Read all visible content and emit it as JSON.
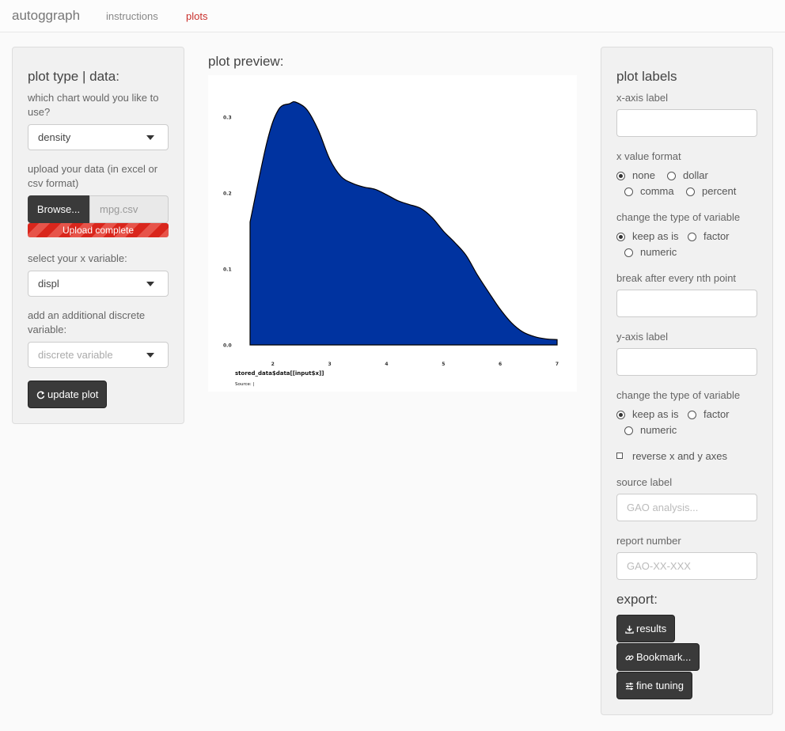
{
  "app": {
    "brand": "autoggraph",
    "nav": [
      {
        "label": "instructions",
        "active": false
      },
      {
        "label": "plots",
        "active": true
      }
    ]
  },
  "left_panel": {
    "title": "plot type | data:",
    "chart_question": "which chart would you like to use?",
    "chart_value": "density",
    "upload_label": "upload your data (in excel or csv format)",
    "browse_label": "Browse...",
    "file_name": "mpg.csv",
    "upload_status": "Upload complete",
    "x_var_label": "select your x variable:",
    "x_var_value": "displ",
    "discrete_label": "add an additional discrete variable:",
    "discrete_placeholder": "discrete variable",
    "update_button": "update plot"
  },
  "preview": {
    "title": "plot preview:",
    "caption": "stored_data$data[[input$x]]",
    "source": "Source:  |"
  },
  "right_panel": {
    "title": "plot labels",
    "x_axis_label": "x-axis label",
    "x_axis_value": "",
    "x_format_label": "x value format",
    "x_format_options": [
      "none",
      "dollar",
      "comma",
      "percent"
    ],
    "x_format_selected": "none",
    "var_type_label_1": "change the type of variable",
    "var_type_options_1": [
      "keep as is",
      "factor",
      "numeric"
    ],
    "var_type_selected_1": "keep as is",
    "break_label": "break after every nth point",
    "break_value": "",
    "y_axis_label": "y-axis label",
    "y_axis_value": "",
    "var_type_label_2": "change the type of variable",
    "var_type_options_2": [
      "keep as is",
      "factor",
      "numeric"
    ],
    "var_type_selected_2": "keep as is",
    "reverse_label": "reverse x and y axes",
    "reverse_checked": false,
    "source_label": "source label",
    "source_placeholder": "GAO analysis...",
    "report_label": "report number",
    "report_placeholder": "GAO-XX-XXX",
    "export_title": "export:",
    "results_button": "results",
    "bookmark_button": "Bookmark...",
    "fine_tuning_button": "fine tuning"
  },
  "chart_data": {
    "type": "area",
    "fill_color": "#0033a0",
    "x": [
      1.6,
      1.9,
      2.1,
      2.3,
      2.4,
      2.6,
      2.8,
      3.0,
      3.2,
      3.4,
      3.6,
      3.8,
      4.0,
      4.2,
      4.4,
      4.6,
      4.8,
      5.0,
      5.2,
      5.4,
      5.6,
      5.8,
      6.0,
      6.2,
      6.4,
      6.6,
      6.8,
      7.0
    ],
    "values": [
      0.162,
      0.268,
      0.31,
      0.318,
      0.32,
      0.31,
      0.283,
      0.245,
      0.222,
      0.213,
      0.208,
      0.205,
      0.198,
      0.19,
      0.185,
      0.18,
      0.168,
      0.15,
      0.135,
      0.118,
      0.092,
      0.069,
      0.047,
      0.029,
      0.017,
      0.011,
      0.008,
      0.007
    ],
    "x_ticks": [
      "2",
      "3",
      "4",
      "5",
      "6",
      "7"
    ],
    "y_ticks": [
      "0.0",
      "0.1",
      "0.2",
      "0.3"
    ],
    "xlim": [
      1.6,
      7.0
    ],
    "ylim": [
      0,
      0.32
    ],
    "xlabel": "stored_data$data[[input$x]]",
    "ylabel": "",
    "grid": false
  }
}
